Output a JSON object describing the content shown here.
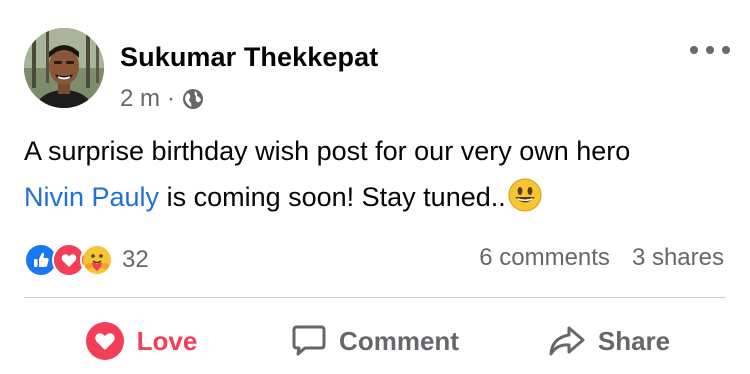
{
  "post": {
    "author": "Sukumar Thekkepat",
    "time": "2 m",
    "separator": "·",
    "audience_icon": "globe-icon",
    "text_line1": "A surprise birthday wish post for our very own hero",
    "mention": "Nivin Pauly",
    "text_line2_rest": " is coming soon! Stay tuned..",
    "emoji": "smiley-face-icon"
  },
  "stats": {
    "reaction_icons": [
      "like-icon",
      "love-icon",
      "care-icon"
    ],
    "reaction_count": "32",
    "comments": "6 comments",
    "shares": "3 shares"
  },
  "actions": {
    "love_label": "Love",
    "comment_label": "Comment",
    "share_label": "Share"
  },
  "colors": {
    "mention": "#216fdb",
    "love": "#f33e58",
    "like_blue": "#1877f2",
    "muted": "#65676b"
  }
}
